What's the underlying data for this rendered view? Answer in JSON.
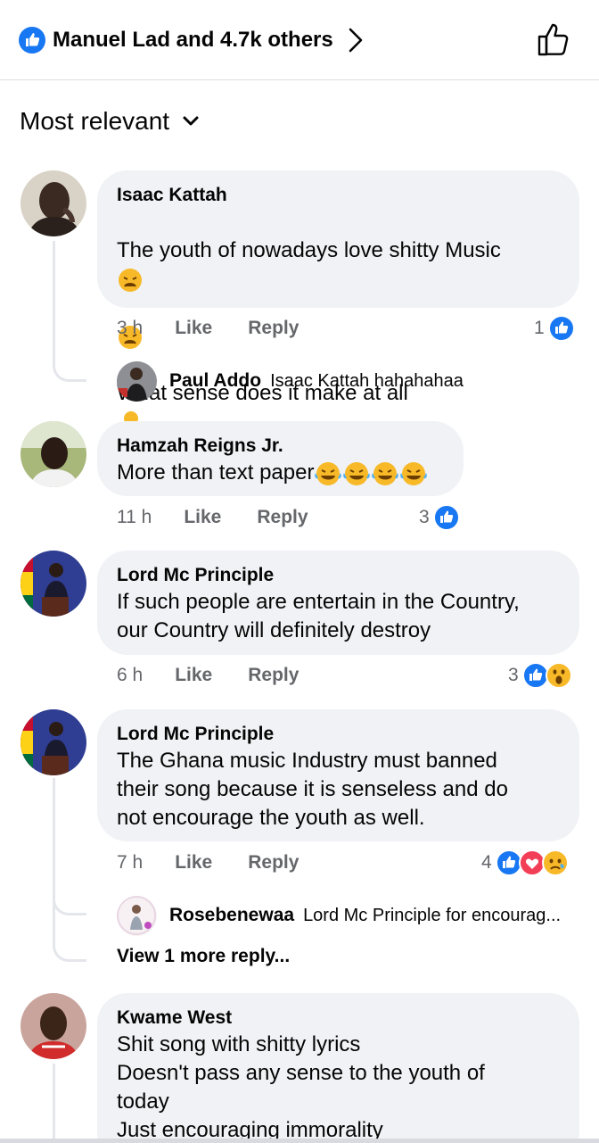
{
  "header": {
    "reactors_label": "Manuel Lad and 4.7k others"
  },
  "sort": {
    "label": "Most relevant"
  },
  "comments": [
    {
      "author": "Isaac Kattah",
      "lines": [
        "The youth of nowadays love shitty Music",
        "What sense does it make at all"
      ],
      "time": "3 h",
      "like_label": "Like",
      "reply_label": "Reply",
      "reaction_count": "1",
      "reactions": [
        "like-icon"
      ]
    },
    {
      "author": "Hamzah Reigns Jr.",
      "lines": [
        "More than text paper"
      ],
      "time": "11 h",
      "like_label": "Like",
      "reply_label": "Reply",
      "reaction_count": "3",
      "reactions": [
        "like-icon"
      ]
    },
    {
      "author": "Lord Mc Principle",
      "lines": [
        "If such people are entertain in the Country,",
        "our Country will definitely destroy"
      ],
      "time": "6 h",
      "like_label": "Like",
      "reply_label": "Reply",
      "reaction_count": "3",
      "reactions": [
        "like-icon",
        "wow-icon"
      ]
    },
    {
      "author": "Lord Mc Principle",
      "lines": [
        "The Ghana music Industry must banned",
        "their song because it is senseless and do",
        "not encourage the youth as well."
      ],
      "time": "7 h",
      "like_label": "Like",
      "reply_label": "Reply",
      "reaction_count": "4",
      "reactions": [
        "like-icon",
        "love-icon",
        "sad-icon"
      ]
    },
    {
      "author": "Kwame West",
      "lines": [
        "Shit song with shitty lyrics",
        "Doesn't pass any sense to the youth of",
        "today",
        "Just encouraging immorality"
      ]
    }
  ],
  "replies": [
    {
      "author": "Paul Addo",
      "text": "Isaac Kattah hahahahaa"
    },
    {
      "author": "Rosebenewaa",
      "text": "Lord Mc Principle  for encourag..."
    }
  ],
  "view_more_label": "View 1 more reply...",
  "colors": {
    "accent": "#1877f2",
    "bubble": "#f0f2f5",
    "meta": "#65676b",
    "love": "#f33e58",
    "emoji": "#f7b928"
  }
}
